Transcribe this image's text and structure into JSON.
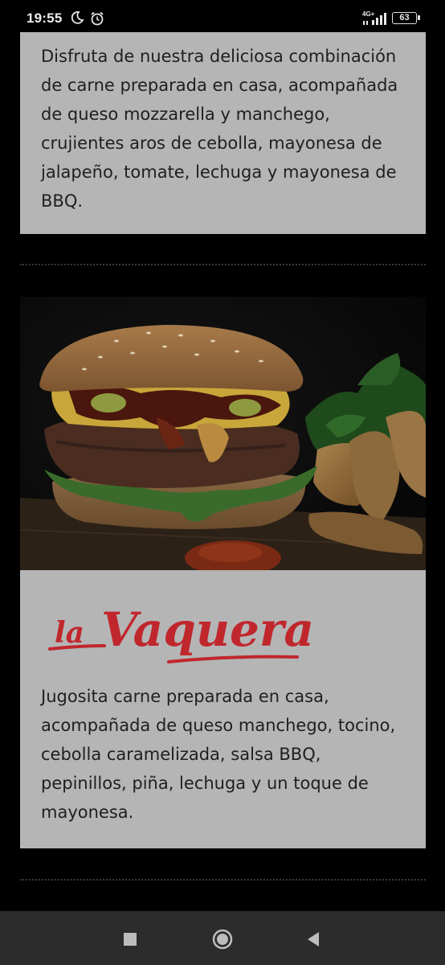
{
  "status_bar": {
    "time": "19:55",
    "network": "4G+",
    "battery": "63",
    "icons": [
      "moon-icon",
      "alarm-icon",
      "signal-icon",
      "battery-icon"
    ]
  },
  "items": [
    {
      "description": "Disfruta de nuestra deliciosa combinación de carne preparada en casa, acompañada de queso mozzarella y manchego, crujientes aros de cebolla, mayonesa de jalapeño, tomate, lechuga y mayonesa de BBQ."
    },
    {
      "logo_article": "la",
      "logo_name": "Vaquera",
      "description": "Jugosita carne preparada en casa, acompañada de queso manchego, tocino, cebolla caramelizada, salsa BBQ, pepinillos, piña, lechuga y un toque de mayonesa."
    }
  ],
  "colors": {
    "page_background": "#000000",
    "card_background": "#b5b5b5",
    "logo_red": "#c0272d",
    "nav_bar": "#2c2c2c"
  },
  "nav_bar": {
    "icons": [
      "recents-icon",
      "home-icon",
      "back-icon"
    ]
  }
}
